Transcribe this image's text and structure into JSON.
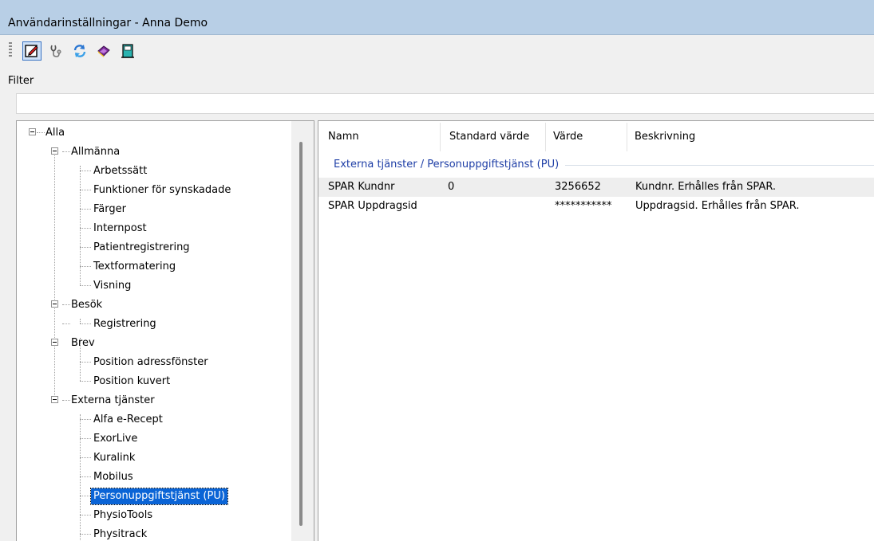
{
  "window": {
    "title": "Användarinställningar - Anna Demo"
  },
  "toolbar": {
    "buttons": [
      {
        "icon": "edit-note-icon"
      },
      {
        "icon": "stethoscope-icon"
      },
      {
        "icon": "refresh-icon"
      },
      {
        "icon": "book-icon"
      },
      {
        "icon": "exit-door-icon"
      }
    ]
  },
  "filter": {
    "label": "Filter",
    "value": ""
  },
  "tree": {
    "root": "Alla",
    "groups": [
      {
        "label": "Allmänna",
        "items": [
          "Arbetssätt",
          "Funktioner för synskadade",
          "Färger",
          "Internpost",
          "Patientregistrering",
          "Textformatering",
          "Visning"
        ]
      },
      {
        "label": "Besök",
        "items": [
          "Registrering"
        ]
      },
      {
        "label": "Brev",
        "items": [
          "Position adressfönster",
          "Position kuvert"
        ]
      },
      {
        "label": "Externa tjänster",
        "items": [
          "Alfa e-Recept",
          "ExorLive",
          "Kuralink",
          "Mobilus",
          "Personuppgiftstjänst (PU)",
          "PhysioTools",
          "Physitrack"
        ]
      }
    ],
    "selected": "Personuppgiftstjänst (PU)"
  },
  "grid": {
    "columns": [
      "Namn",
      "Standard värde",
      "Värde",
      "Beskrivning"
    ],
    "group_title": "Externa tjänster / Personuppgiftstjänst (PU)",
    "rows": [
      {
        "namn": "SPAR Kundnr",
        "standard": "0",
        "varde": "3256652",
        "beskrivning": "Kundnr. Erhålles från SPAR."
      },
      {
        "namn": "SPAR Uppdragsid",
        "standard": "",
        "varde": "***********",
        "beskrivning": "Uppdragsid. Erhålles från SPAR."
      }
    ]
  }
}
